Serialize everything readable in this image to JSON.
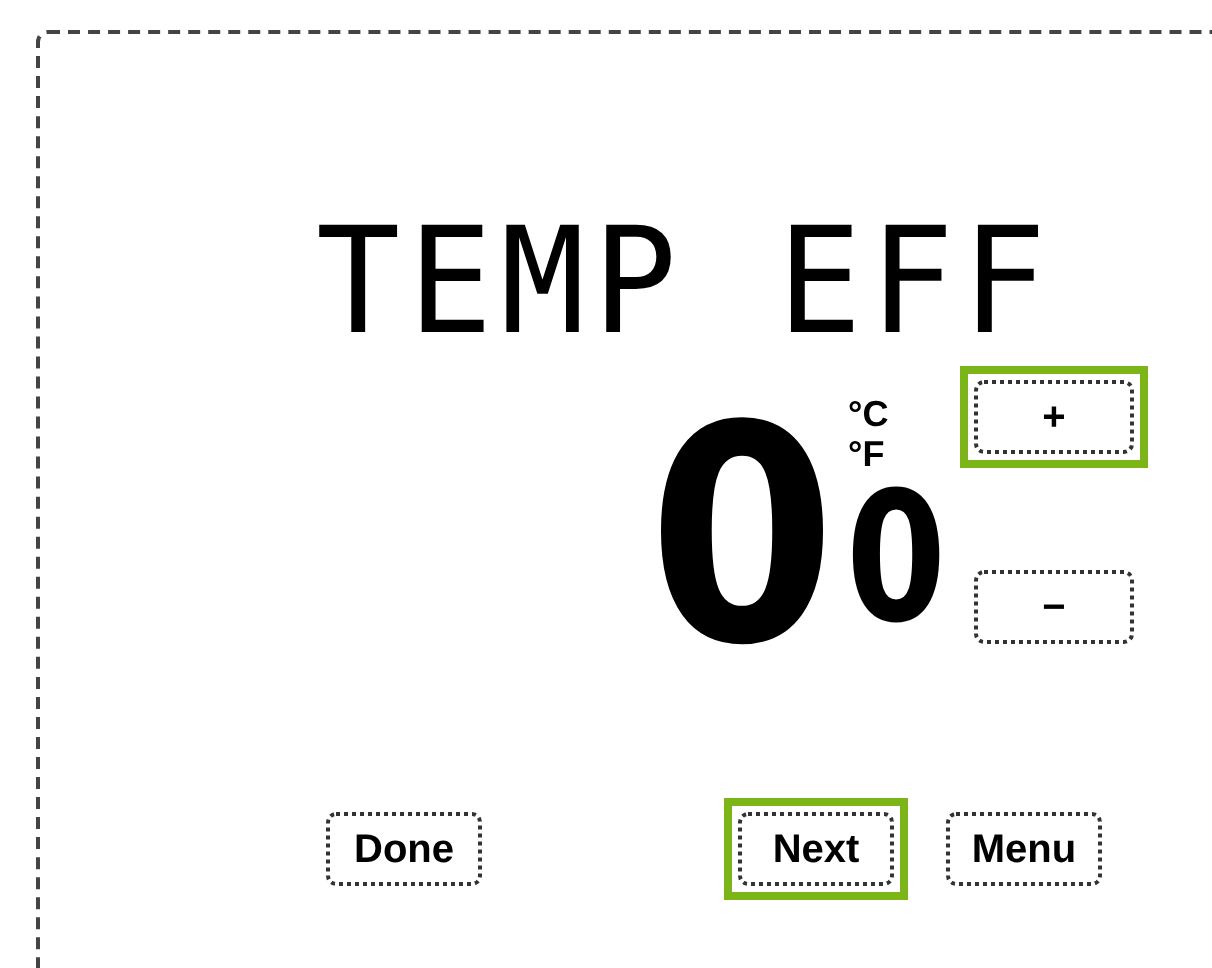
{
  "display": {
    "title": "TEMP EFF",
    "main_digit": "0",
    "small_digit": "0",
    "units": [
      "°C",
      "°F"
    ]
  },
  "adjust_buttons": [
    {
      "label": "+",
      "highlighted": true
    },
    {
      "label": "−",
      "highlighted": false
    }
  ],
  "bottom_buttons": [
    {
      "label": "Done",
      "highlighted": false
    },
    {
      "label": "Next",
      "highlighted": true
    },
    {
      "label": "Menu",
      "highlighted": false
    }
  ]
}
